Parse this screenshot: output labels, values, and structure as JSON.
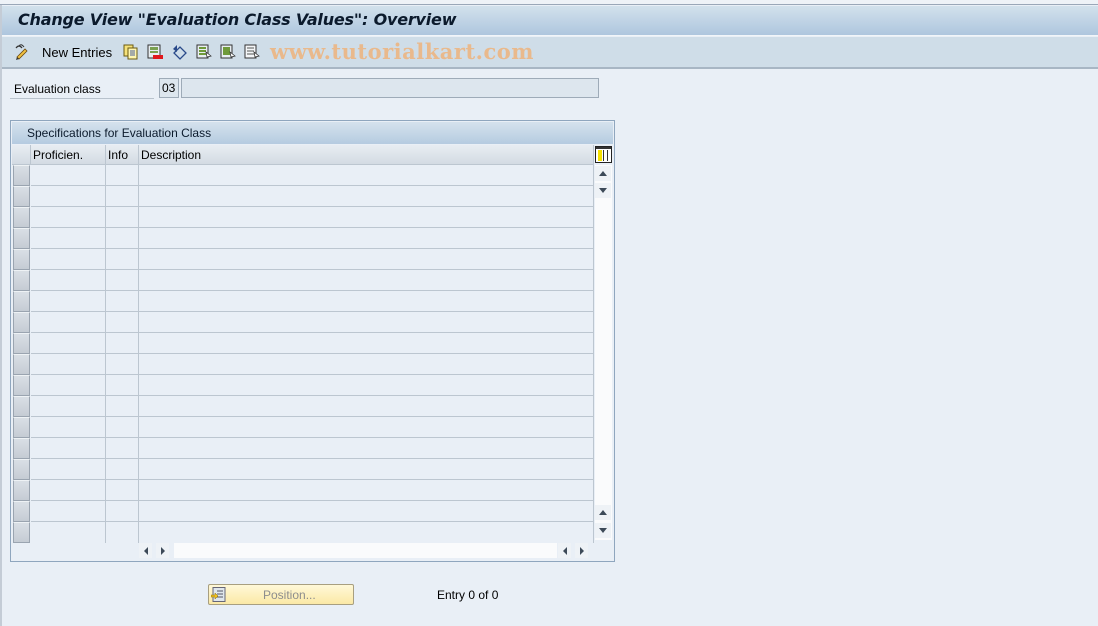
{
  "window": {
    "title": "Change View \"Evaluation Class Values\": Overview"
  },
  "toolbar": {
    "items": [
      {
        "icon": "edit-pencil-icon",
        "label": ""
      },
      {
        "icon": "",
        "label": "New Entries"
      },
      {
        "icon": "copy-icon",
        "label": ""
      },
      {
        "icon": "delete-icon",
        "label": ""
      },
      {
        "icon": "undo-change-icon",
        "label": ""
      },
      {
        "icon": "select-all-icon",
        "label": ""
      },
      {
        "icon": "select-block-icon",
        "label": ""
      },
      {
        "icon": "deselect-all-icon",
        "label": ""
      }
    ],
    "watermark": "www.tutorialkart.com"
  },
  "header_fields": {
    "evaluation_class": {
      "label": "Evaluation class",
      "value": "03",
      "description": ""
    }
  },
  "table": {
    "caption": "Specifications for Evaluation Class",
    "columns": [
      "Proficien.",
      "Info",
      "Description"
    ],
    "rows": [
      [
        "",
        "",
        ""
      ],
      [
        "",
        "",
        ""
      ],
      [
        "",
        "",
        ""
      ],
      [
        "",
        "",
        ""
      ],
      [
        "",
        "",
        ""
      ],
      [
        "",
        "",
        ""
      ],
      [
        "",
        "",
        ""
      ],
      [
        "",
        "",
        ""
      ],
      [
        "",
        "",
        ""
      ],
      [
        "",
        "",
        ""
      ],
      [
        "",
        "",
        ""
      ],
      [
        "",
        "",
        ""
      ],
      [
        "",
        "",
        ""
      ],
      [
        "",
        "",
        ""
      ],
      [
        "",
        "",
        ""
      ],
      [
        "",
        "",
        ""
      ],
      [
        "",
        "",
        ""
      ],
      [
        "",
        "",
        ""
      ]
    ]
  },
  "footer": {
    "position_button": "Position...",
    "entry_status": "Entry 0 of 0"
  },
  "colors": {
    "background": "#e9eff6",
    "titlebar": "#aec6de",
    "toolbar": "#cfdde8",
    "position_button": "#fbe9a6",
    "watermark": "#e9b98c"
  }
}
